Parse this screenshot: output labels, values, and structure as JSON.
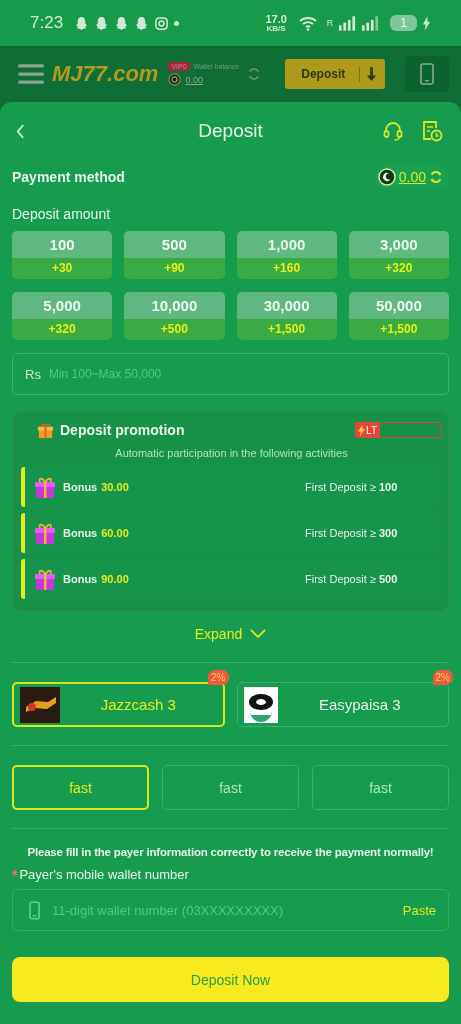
{
  "status_bar": {
    "time": "7:23",
    "net_speed": "17.0",
    "net_unit": "KB/S",
    "roaming": "R",
    "battery": "1"
  },
  "header": {
    "logo": "MJ77.com",
    "vip": "VIP0",
    "wallet_label": "Wallet balance",
    "balance": "0.00",
    "deposit_button": "Deposit"
  },
  "title": "Deposit",
  "payment_method": {
    "label": "Payment method",
    "balance": "0.00"
  },
  "deposit_amount": {
    "label": "Deposit amount",
    "options": [
      {
        "amount": "100",
        "bonus": "+30"
      },
      {
        "amount": "500",
        "bonus": "+90"
      },
      {
        "amount": "1,000",
        "bonus": "+160"
      },
      {
        "amount": "3,000",
        "bonus": "+320"
      },
      {
        "amount": "5,000",
        "bonus": "+320"
      },
      {
        "amount": "10,000",
        "bonus": "+500"
      },
      {
        "amount": "30,000",
        "bonus": "+1,500"
      },
      {
        "amount": "50,000",
        "bonus": "+1,500"
      }
    ],
    "field": {
      "currency": "Rs",
      "placeholder": "Min 100~Max 50,000"
    }
  },
  "promotion": {
    "title": "Deposit promotion",
    "badge": "LT",
    "subtitle": "Automatic participation in the following activities",
    "items": [
      {
        "label": "Bonus",
        "amount": "30.00",
        "condition": "First Deposit ≥ **100**"
      },
      {
        "label": "Bonus",
        "amount": "60.00",
        "condition": "First Deposit ≥ **300**"
      },
      {
        "label": "Bonus",
        "amount": "90.00",
        "condition": "First Deposit ≥ **500**"
      }
    ],
    "expand": {
      "label": "Expand",
      "expanded": false
    }
  },
  "channels": [
    {
      "kind": "jazzcash",
      "name": "Jazzcash 3",
      "fee": "2%",
      "selected": true
    },
    {
      "kind": "easypaisa",
      "name": "Easypaisa 3",
      "fee": "2%",
      "selected": false
    }
  ],
  "speeds": [
    {
      "label": "fast",
      "selected": true
    },
    {
      "label": "fast",
      "selected": false
    },
    {
      "label": "fast",
      "selected": false
    }
  ],
  "notice": "Please fill in the payer information correctly to receive the payment normally!",
  "wallet_field": {
    "required_mark": "*",
    "label": "Payer's mobile wallet number",
    "placeholder": "11-digit wallet number (03XXXXXXXXX)",
    "paste": "Paste"
  },
  "submit": "Deposit Now"
}
